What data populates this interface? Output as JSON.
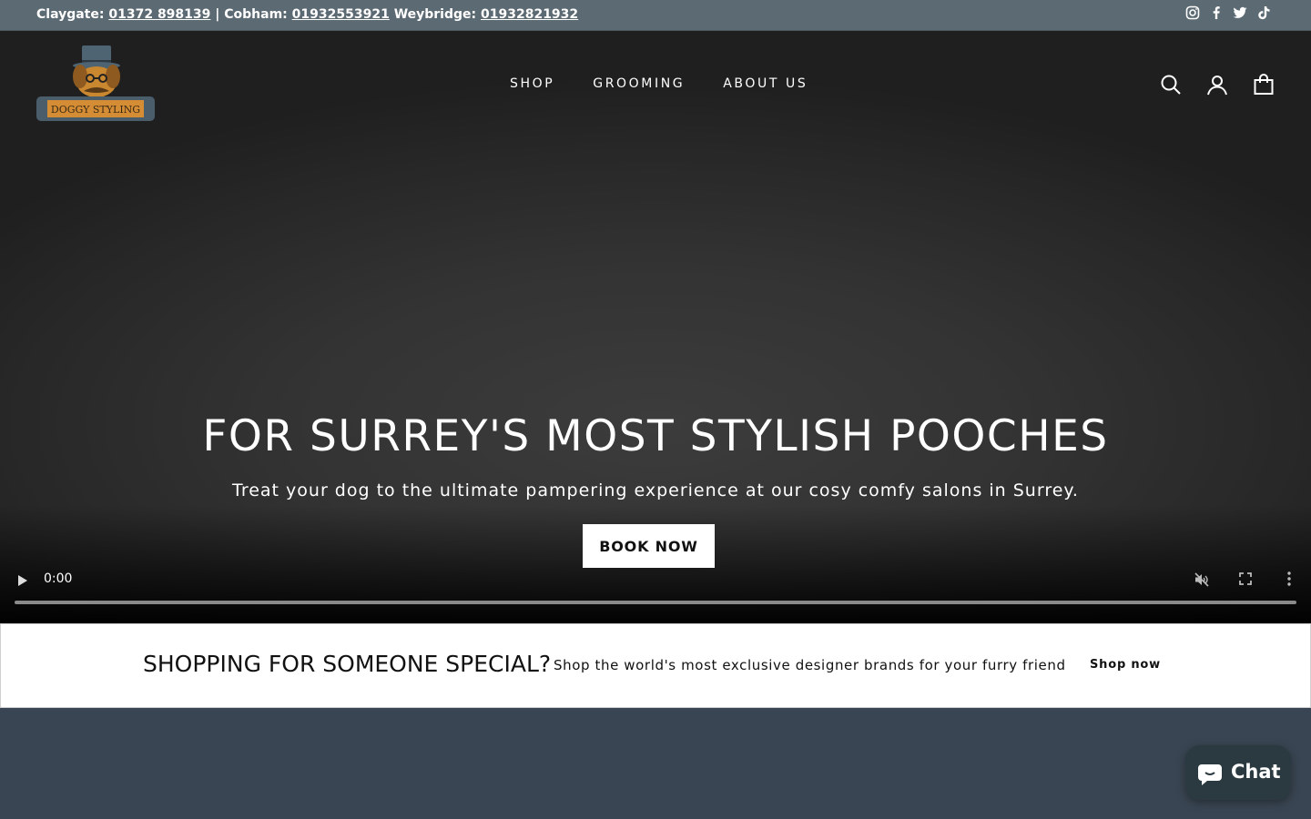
{
  "topbar": {
    "claygate_label": "Claygate:",
    "claygate_phone": "01372 898139",
    "sep": "|",
    "cobham_label": "Cobham:",
    "cobham_phone": "01932553921",
    "weybridge_label": "Weybridge:",
    "weybridge_phone": "01932821932",
    "social_icons": [
      "instagram-icon",
      "facebook-icon",
      "twitter-icon",
      "tiktok-icon"
    ]
  },
  "header": {
    "logo_text": "DOGGY STYLING",
    "nav": [
      "SHOP",
      "GROOMING",
      "ABOUT US"
    ],
    "icons": [
      "search-icon",
      "account-icon",
      "cart-icon"
    ]
  },
  "hero": {
    "title": "FOR SURREY'S MOST STYLISH POOCHES",
    "subtitle": "Treat your dog to the ultimate pampering experience at our cosy comfy salons in Surrey.",
    "button": "BOOK NOW"
  },
  "video": {
    "time": "0:00",
    "muted": true
  },
  "promo": {
    "title": "SHOPPING FOR SOMEONE SPECIAL?",
    "text": "Shop the world's most exclusive designer brands for your furry friend",
    "link": "Shop now"
  },
  "chat": {
    "label": "Chat"
  },
  "colors": {
    "topbar": "#5c6a73",
    "page_bg": "#394552",
    "logo_gold": "#d58d35",
    "chat_bg": "#2b3a40"
  }
}
